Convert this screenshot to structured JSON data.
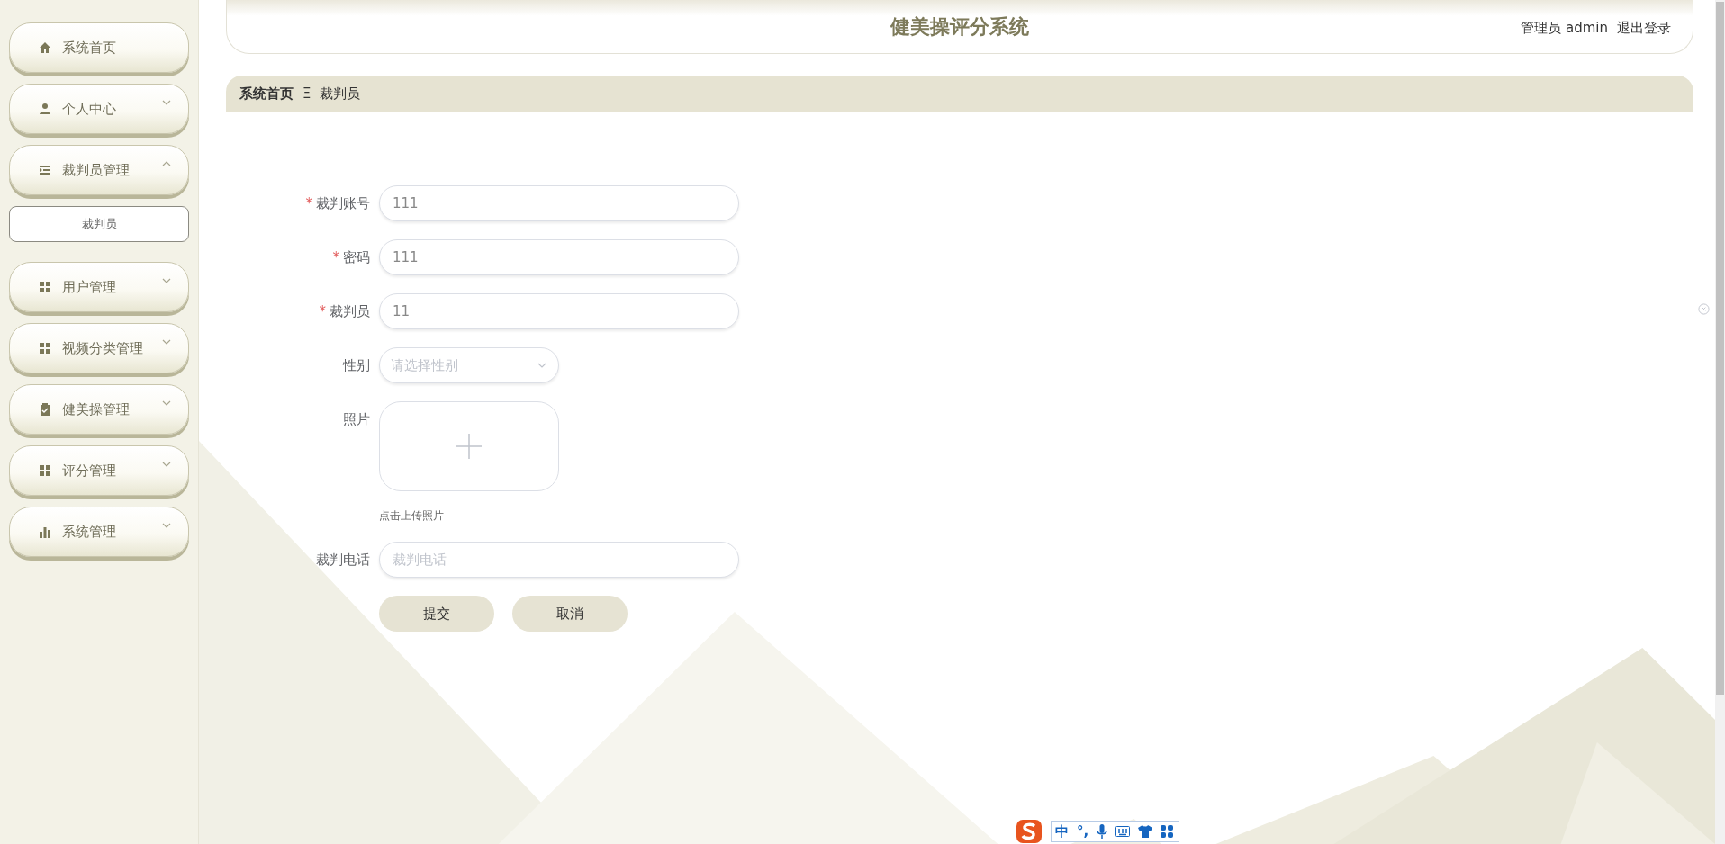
{
  "sidebar": {
    "items": [
      {
        "label": "系统首页",
        "kind": "link"
      },
      {
        "label": "个人中心",
        "kind": "menu",
        "expanded": false
      },
      {
        "label": "裁判员管理",
        "kind": "menu",
        "expanded": true,
        "children": [
          {
            "label": "裁判员"
          }
        ]
      },
      {
        "label": "用户管理",
        "kind": "menu",
        "expanded": false
      },
      {
        "label": "视频分类管理",
        "kind": "menu",
        "expanded": false
      },
      {
        "label": "健美操管理",
        "kind": "menu",
        "expanded": false
      },
      {
        "label": "评分管理",
        "kind": "menu",
        "expanded": false
      },
      {
        "label": "系统管理",
        "kind": "menu",
        "expanded": false
      }
    ]
  },
  "header": {
    "title": "健美操评分系统",
    "user": "管理员 admin",
    "logout": "退出登录"
  },
  "breadcrumb": {
    "items": [
      "系统首页",
      "裁判员"
    ],
    "separator": "Ξ"
  },
  "form": {
    "fields": [
      {
        "label": "裁判账号",
        "required_mark": "*",
        "kind": "text",
        "value": "111"
      },
      {
        "label": "密码",
        "required_mark": "*",
        "kind": "text",
        "value": "111"
      },
      {
        "label": "裁判员",
        "required_mark": "*",
        "kind": "text",
        "value": "11"
      },
      {
        "label": "性别",
        "kind": "select",
        "placeholder": "请选择性别"
      },
      {
        "label": "照片",
        "kind": "upload",
        "hint": "点击上传照片"
      },
      {
        "label": "裁判电话",
        "kind": "text",
        "placeholder": "裁判电话"
      }
    ],
    "buttons": [
      "提交",
      "取消"
    ]
  },
  "ime_toolbar": {
    "mode": "中",
    "punctuation": "°,"
  }
}
